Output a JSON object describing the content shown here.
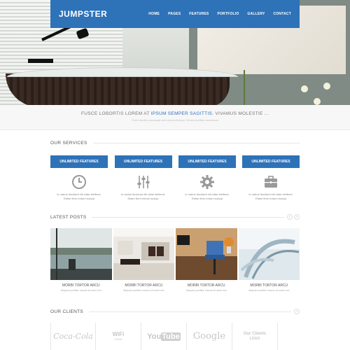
{
  "header": {
    "logo": "JUMPSTER",
    "menu": [
      "HOME",
      "PAGES",
      "FEATURES",
      "PORTFOLIO",
      "GALLERY",
      "CONTACT"
    ]
  },
  "tagline": {
    "pre": "FUSCE LOBORTIS LOREM AT ",
    "highlight": "IPSUM SEMPER SAGITTIS",
    "post": ". VIVAMUS MOLESTIE ...",
    "sub": "Proin iaculis consequat sem cursus tempor. Donec porttitor accumsan"
  },
  "services": {
    "title": "OUR SERVICES",
    "items": [
      {
        "button": "UNLIMITED FEATURES",
        "icon": "clock-icon",
        "text": "In varius tincidunt elit vitae eleifend. Etiam ferm entum suscip"
      },
      {
        "button": "UNLIMITED FEATURES",
        "icon": "sliders-icon",
        "text": "In varius tincidunt elit vitae eleifend. Etiam ferm entum suscip"
      },
      {
        "button": "UNLIMITED FEATURES",
        "icon": "gear-icon",
        "text": "In varius tincidunt elit vitae eleifend. Etiam ferm entum suscip"
      },
      {
        "button": "UNLIMITED FEATURES",
        "icon": "briefcase-icon",
        "text": "In varius tincidunt elit vitae eleifend. Etiam ferm entum suscip"
      }
    ]
  },
  "posts": {
    "title": "LATEST POSTS",
    "prev": "‹",
    "next": "›",
    "items": [
      {
        "title": "MORBI TORTOR ARCU",
        "sub": "Aliquam porttitor mauris sit amet orci"
      },
      {
        "title": "MORBI TORTOR ARCU",
        "sub": "Aliquam porttitor mauris sit amet orci"
      },
      {
        "title": "MORBI TORTOR ARCU",
        "sub": "Aliquam porttitor mauris sit amet orci"
      },
      {
        "title": "MORBI TORTOR ARCU",
        "sub": "Aliquam porttitor mauris sit amet orci"
      }
    ]
  },
  "clients": {
    "title": "OUR CLIENTS",
    "next": "›",
    "logos": [
      "Coca-Cola",
      "WiFi ZONE",
      "YouTube",
      "Google",
      "Our Clients LOGO"
    ],
    "wifi_top": "WiFi",
    "wifi_bottom": "ZONE",
    "youtube_a": "You",
    "youtube_b": "Tube",
    "ourclients_a": "Our Clients",
    "ourclients_b": "LOGO"
  },
  "colors": {
    "brand": "#2e72b8"
  }
}
